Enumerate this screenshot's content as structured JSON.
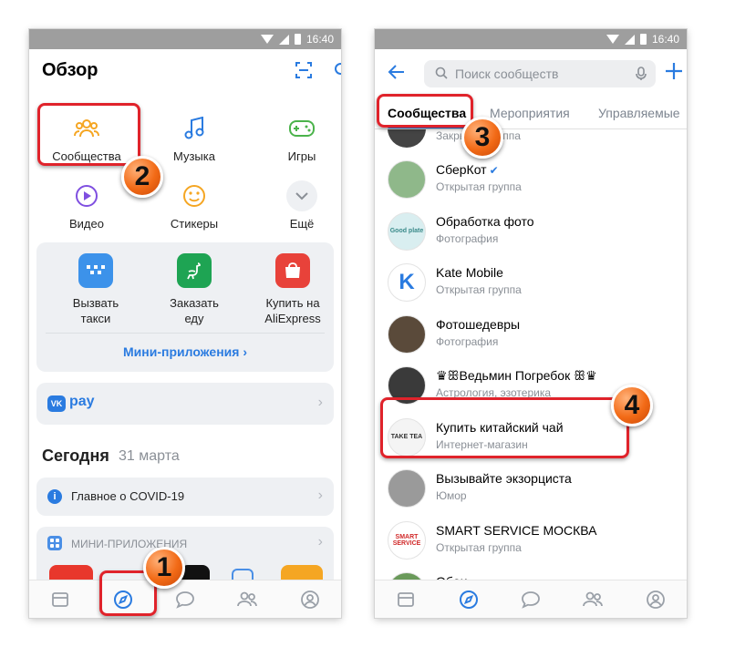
{
  "status": {
    "time": "16:40"
  },
  "left": {
    "title": "Обзор",
    "grid": [
      {
        "label": "Сообщества",
        "icon": "people-icon",
        "color": "#f5a623"
      },
      {
        "label": "Музыка",
        "icon": "music-icon",
        "color": "#2a7be0"
      },
      {
        "label": "Игры",
        "icon": "gamepad-icon",
        "color": "#4bb34b"
      },
      {
        "label": "Видео",
        "icon": "play-icon",
        "color": "#7f4fe0"
      },
      {
        "label": "Стикеры",
        "icon": "smile-icon",
        "color": "#f5a623"
      },
      {
        "label": "Ещё",
        "icon": "chevron-down-icon",
        "color": "#8a8f96"
      }
    ],
    "apps": [
      {
        "label": "Вызвать\nтакси",
        "color": "#3c92ea"
      },
      {
        "label": "Заказать\nеду",
        "color": "#1ea453"
      },
      {
        "label": "Купить на\nAliExpress",
        "color": "#e8423a"
      }
    ],
    "mini_apps_link": "Мини-приложения ›",
    "pay_label": "pay",
    "pay_vk": "VK",
    "today_label": "Сегодня",
    "today_date": "31 марта",
    "covid": "Главное о COVID-19",
    "mini_apps_header": "МИНИ-ПРИЛОЖЕНИЯ"
  },
  "right": {
    "search_placeholder": "Поиск сообществ",
    "tabs": [
      "Сообщества",
      "Мероприятия",
      "Управляемые"
    ],
    "partial_top_sub": "Закрытая группа",
    "communities": [
      {
        "name": "СберКот",
        "sub": "Открытая группа",
        "verified": true,
        "avatar_color": "#8fb88a",
        "avatar_text": "",
        "avatar_text_color": "#fff"
      },
      {
        "name": "Обработка фото",
        "sub": "Фотография",
        "verified": false,
        "avatar_color": "#d9eef0",
        "avatar_text": "Good plate",
        "avatar_text_color": "#3a8a8a"
      },
      {
        "name": "Kate Mobile",
        "sub": "Открытая группа",
        "verified": false,
        "avatar_color": "#ffffff",
        "avatar_text": "K",
        "avatar_text_color": "#2a7be0"
      },
      {
        "name": "Фотошедевры",
        "sub": "Фотография",
        "verified": false,
        "avatar_color": "#5a4a3a",
        "avatar_text": "",
        "avatar_text_color": "#fff"
      },
      {
        "name": "♛ꕥВедьмин Погребок ꕥ♛",
        "sub": "Астрология, эзотерика",
        "verified": false,
        "avatar_color": "#3a3a3a",
        "avatar_text": "",
        "avatar_text_color": "#fff"
      },
      {
        "name": "Купить китайский чай",
        "sub": "Интернет-магазин",
        "verified": false,
        "avatar_color": "#f4f4f4",
        "avatar_text": "TAKE TEA",
        "avatar_text_color": "#333"
      },
      {
        "name": "Вызывайте экзорциста",
        "sub": "Юмор",
        "verified": false,
        "avatar_color": "#9a9a9a",
        "avatar_text": "",
        "avatar_text_color": "#fff"
      },
      {
        "name": "SMART SERVICE МОСКВА",
        "sub": "Открытая группа",
        "verified": false,
        "avatar_color": "#ffffff",
        "avatar_text": "SMART SERVICE",
        "avatar_text_color": "#d12a2a"
      },
      {
        "name": "Обои",
        "sub": "",
        "verified": false,
        "avatar_color": "#6a9a5a",
        "avatar_text": "",
        "avatar_text_color": "#fff"
      }
    ]
  },
  "annotations": [
    "1",
    "2",
    "3",
    "4"
  ],
  "colors": {
    "accent": "#2a7be0",
    "highlight": "#e0232b",
    "badge": "#f26a16"
  }
}
